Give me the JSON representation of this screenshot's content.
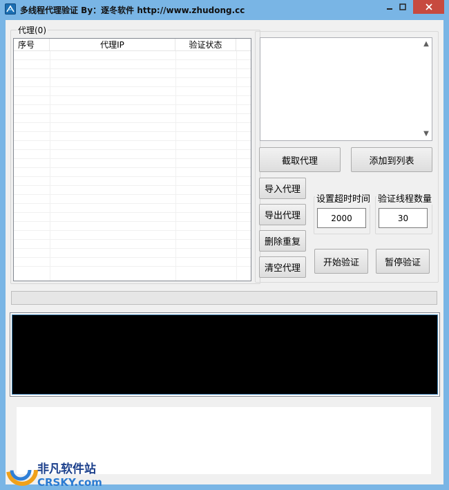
{
  "window": {
    "title": "多线程代理验证 By：逐冬软件 http://www.zhudong.cc",
    "controls": [
      "minimize-icon",
      "maximize-icon",
      "close-icon"
    ]
  },
  "proxy_group": {
    "title": "代理(0)",
    "columns": [
      "序号",
      "代理IP",
      "验证状态"
    ],
    "rows": []
  },
  "input_box": {
    "value": ""
  },
  "buttons": {
    "capture": "截取代理",
    "add_to_list": "添加到列表",
    "import": "导入代理",
    "export": "导出代理",
    "dedupe": "删除重复",
    "clear": "清空代理",
    "start": "开始验证",
    "pause": "暂停验证"
  },
  "settings": {
    "timeout_label": "设置超时时间",
    "timeout_value": "2000",
    "threads_label": "验证线程数量",
    "threads_value": "30"
  },
  "progress": {
    "value": 0
  },
  "log": {
    "text": ""
  },
  "watermark": {
    "cn": "非凡软件站",
    "en": "CRSKY.com"
  },
  "colors": {
    "titlebar": "#79b5e5",
    "close_button": "#c74a3f",
    "client_bg": "#f0f0f0",
    "log_bg": "#000000",
    "progress_fill": "#06b025"
  }
}
